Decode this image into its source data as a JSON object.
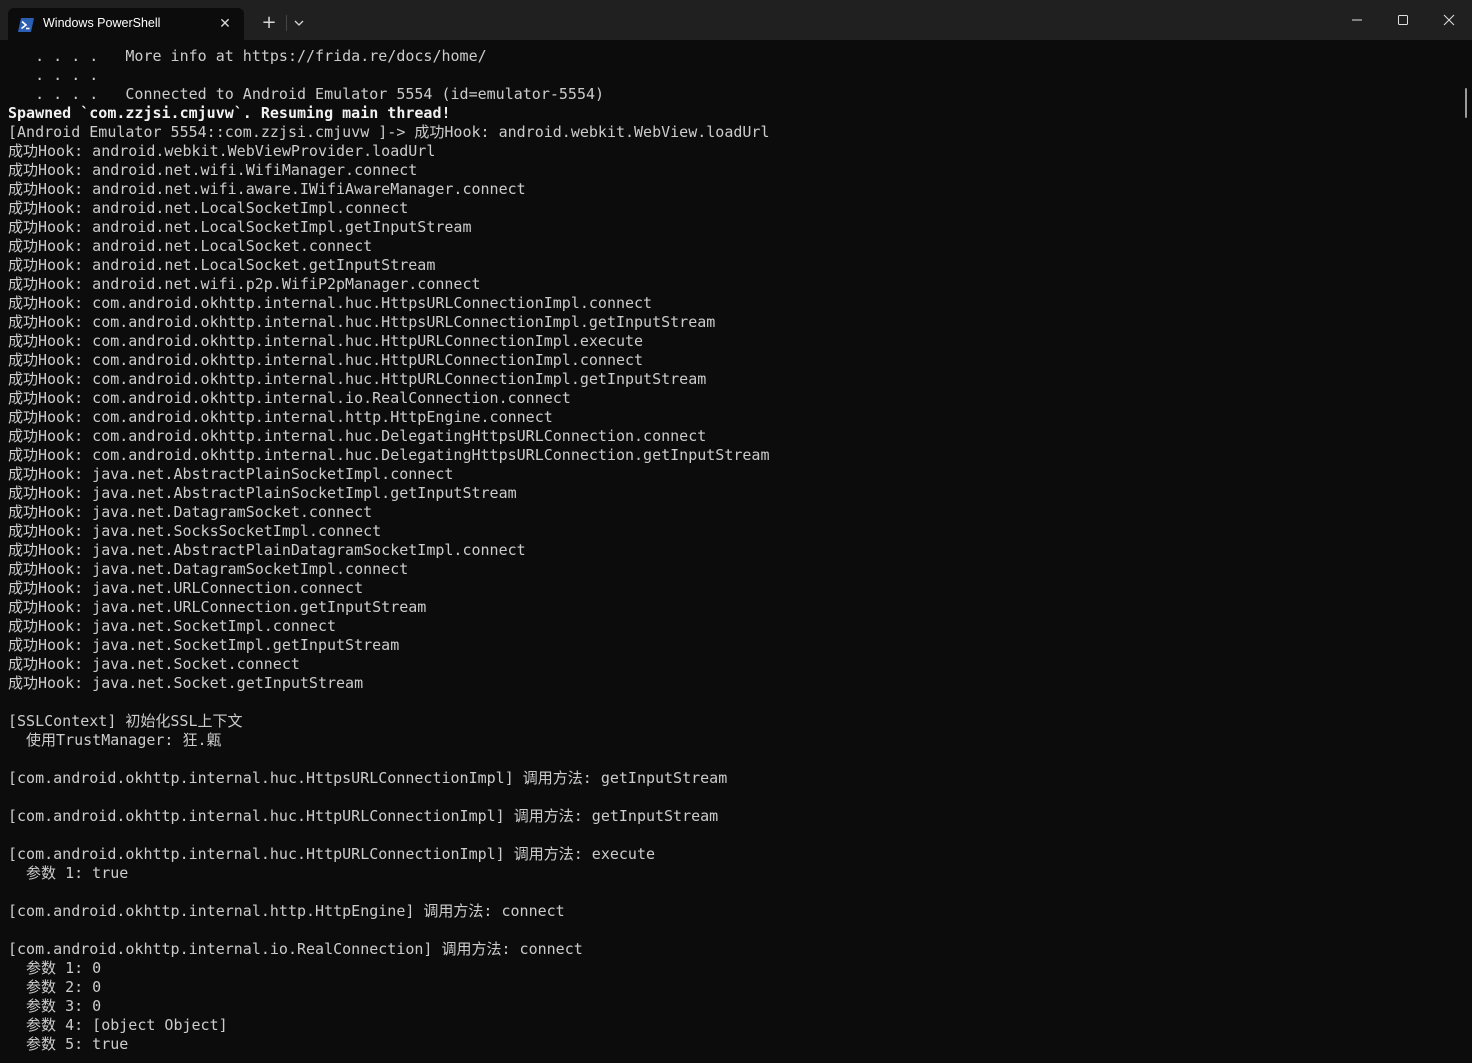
{
  "window": {
    "tab_title": "Windows PowerShell",
    "tab_close": "✕",
    "new_tab": "+",
    "icons": [
      "powershell-icon",
      "close-icon",
      "plus-icon",
      "chevron-down-icon",
      "minimize-icon",
      "maximize-icon",
      "window-close-icon"
    ],
    "colors": {
      "titlebar": "#202020",
      "terminal_bg": "#0c0c0c",
      "text": "#cccccc",
      "powershell_blue": "#2b5fb4"
    }
  },
  "terminal": {
    "lines": [
      "   . . . .   More info at https://frida.re/docs/home/",
      "   . . . .",
      "   . . . .   Connected to Android Emulator 5554 (id=emulator-5554)",
      "Spawned `com.zzjsi.cmjuvw`. Resuming main thread!",
      "[Android Emulator 5554::com.zzjsi.cmjuvw ]-> 成功Hook: android.webkit.WebView.loadUrl",
      "成功Hook: android.webkit.WebViewProvider.loadUrl",
      "成功Hook: android.net.wifi.WifiManager.connect",
      "成功Hook: android.net.wifi.aware.IWifiAwareManager.connect",
      "成功Hook: android.net.LocalSocketImpl.connect",
      "成功Hook: android.net.LocalSocketImpl.getInputStream",
      "成功Hook: android.net.LocalSocket.connect",
      "成功Hook: android.net.LocalSocket.getInputStream",
      "成功Hook: android.net.wifi.p2p.WifiP2pManager.connect",
      "成功Hook: com.android.okhttp.internal.huc.HttpsURLConnectionImpl.connect",
      "成功Hook: com.android.okhttp.internal.huc.HttpsURLConnectionImpl.getInputStream",
      "成功Hook: com.android.okhttp.internal.huc.HttpURLConnectionImpl.execute",
      "成功Hook: com.android.okhttp.internal.huc.HttpURLConnectionImpl.connect",
      "成功Hook: com.android.okhttp.internal.huc.HttpURLConnectionImpl.getInputStream",
      "成功Hook: com.android.okhttp.internal.io.RealConnection.connect",
      "成功Hook: com.android.okhttp.internal.http.HttpEngine.connect",
      "成功Hook: com.android.okhttp.internal.huc.DelegatingHttpsURLConnection.connect",
      "成功Hook: com.android.okhttp.internal.huc.DelegatingHttpsURLConnection.getInputStream",
      "成功Hook: java.net.AbstractPlainSocketImpl.connect",
      "成功Hook: java.net.AbstractPlainSocketImpl.getInputStream",
      "成功Hook: java.net.DatagramSocket.connect",
      "成功Hook: java.net.SocksSocketImpl.connect",
      "成功Hook: java.net.AbstractPlainDatagramSocketImpl.connect",
      "成功Hook: java.net.DatagramSocketImpl.connect",
      "成功Hook: java.net.URLConnection.connect",
      "成功Hook: java.net.URLConnection.getInputStream",
      "成功Hook: java.net.SocketImpl.connect",
      "成功Hook: java.net.SocketImpl.getInputStream",
      "成功Hook: java.net.Socket.connect",
      "成功Hook: java.net.Socket.getInputStream",
      "",
      "[SSLContext] 初始化SSL上下文",
      "  使用TrustManager: 狂.甈",
      "",
      "[com.android.okhttp.internal.huc.HttpsURLConnectionImpl] 调用方法: getInputStream",
      "",
      "[com.android.okhttp.internal.huc.HttpURLConnectionImpl] 调用方法: getInputStream",
      "",
      "[com.android.okhttp.internal.huc.HttpURLConnectionImpl] 调用方法: execute",
      "  参数 1: true",
      "",
      "[com.android.okhttp.internal.http.HttpEngine] 调用方法: connect",
      "",
      "[com.android.okhttp.internal.io.RealConnection] 调用方法: connect",
      "  参数 1: 0",
      "  参数 2: 0",
      "  参数 3: 0",
      "  参数 4: [object Object]",
      "  参数 5: true"
    ]
  }
}
